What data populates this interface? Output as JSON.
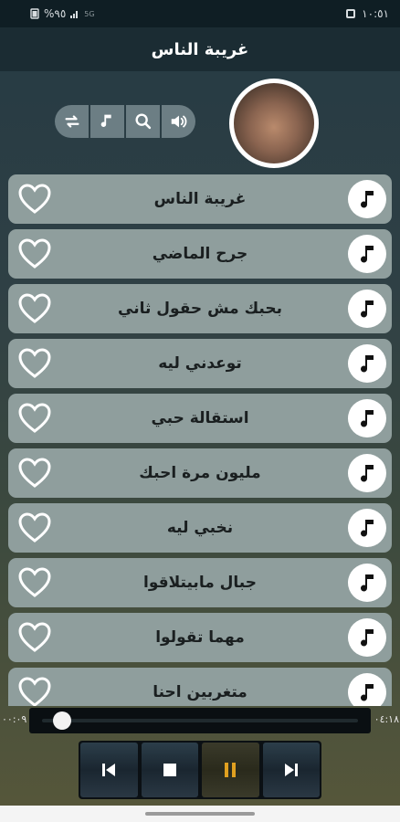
{
  "status": {
    "battery": "%٩٥",
    "network": "5G",
    "time": "١٠:٥١"
  },
  "app": {
    "title": "غريبة الناس"
  },
  "controls": [
    {
      "icon": "repeat-icon"
    },
    {
      "icon": "music-note-icon"
    },
    {
      "icon": "search-icon"
    },
    {
      "icon": "volume-icon"
    }
  ],
  "songs": [
    {
      "title": "غريبة الناس"
    },
    {
      "title": "جرح الماضي"
    },
    {
      "title": "بحبك مش حقول ثاني"
    },
    {
      "title": "توعدني ليه"
    },
    {
      "title": "استقالة حبي"
    },
    {
      "title": "مليون مرة احبك"
    },
    {
      "title": "نخبي ليه"
    },
    {
      "title": "جبال مابيتلاقوا"
    },
    {
      "title": "مهما تقولوا"
    },
    {
      "title": "متغربين احنا"
    }
  ],
  "player": {
    "elapsed": "٠٠:٠٩",
    "duration": "٠٤:١٨",
    "progress": 0.036
  },
  "colors": {
    "accent_pause": "#e0a020",
    "row_bg": "#8f9e9d",
    "app_bar": "#1b2c33"
  }
}
